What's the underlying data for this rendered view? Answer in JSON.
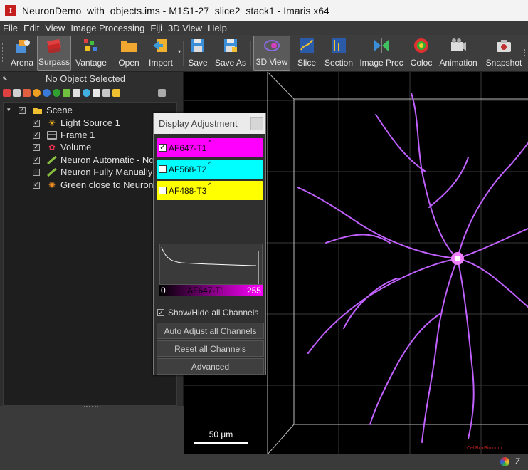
{
  "window": {
    "title": "NeuronDemo_with_objects.ims - M1S1-27_slice2_stack1 - Imaris x64",
    "app_icon": "I"
  },
  "menu": [
    "File",
    "Edit",
    "View",
    "Image Processing",
    "Fiji",
    "3D View",
    "Help"
  ],
  "toolbar": [
    {
      "label": "Arena",
      "icon": "arena-icon"
    },
    {
      "label": "Surpass",
      "icon": "surpass-icon",
      "active": true
    },
    {
      "label": "Vantage",
      "icon": "vantage-icon"
    },
    {
      "label": "Open",
      "icon": "open-folder-icon"
    },
    {
      "label": "Import",
      "icon": "import-icon"
    },
    {
      "label": "Save",
      "icon": "save-icon"
    },
    {
      "label": "Save As",
      "icon": "save-as-icon"
    },
    {
      "label": "3D View",
      "icon": "3d-view-icon",
      "active": true
    },
    {
      "label": "Slice",
      "icon": "slice-icon"
    },
    {
      "label": "Section",
      "icon": "section-icon"
    },
    {
      "label": "Image Proc",
      "icon": "image-proc-icon"
    },
    {
      "label": "Coloc",
      "icon": "coloc-icon"
    },
    {
      "label": "Animation",
      "icon": "animation-icon"
    },
    {
      "label": "Snapshot",
      "icon": "snapshot-icon"
    }
  ],
  "left_panel": {
    "selection_label": "No Object Selected",
    "tree": [
      {
        "label": "Scene",
        "checked": true,
        "expanded": true,
        "icon": "folder-icon",
        "level": 0
      },
      {
        "label": "Light Source 1",
        "checked": true,
        "icon": "sun-icon",
        "level": 1
      },
      {
        "label": "Frame 1",
        "checked": true,
        "icon": "frame-icon",
        "level": 1
      },
      {
        "label": "Volume",
        "checked": true,
        "icon": "volume-icon",
        "level": 1
      },
      {
        "label": "Neuron Automatic - No",
        "checked": true,
        "icon": "neuron-icon",
        "level": 1
      },
      {
        "label": "Neuron Fully Manually I",
        "checked": false,
        "icon": "neuron-icon",
        "level": 1
      },
      {
        "label": "Green close to Neuron",
        "checked": true,
        "icon": "spots-icon",
        "level": 1
      }
    ]
  },
  "display_adjustment": {
    "title": "Display Adjustment",
    "channels": [
      {
        "name": "AF647-T1",
        "checked": true,
        "color": "#ff00ff"
      },
      {
        "name": "AF568-T2",
        "checked": false,
        "color": "#00ffff"
      },
      {
        "name": "AF488-T3",
        "checked": false,
        "color": "#ffff00"
      }
    ],
    "range_min": "0",
    "range_channel": "AF647-T1",
    "range_max": "255",
    "show_hide_label": "Show/Hide all Channels",
    "show_hide_checked": true,
    "buttons": [
      "Auto Adjust all Channels",
      "Reset all Channels",
      "Advanced"
    ]
  },
  "viewer": {
    "scale_label": "50 µm",
    "watermark": "CellBoxBio.com"
  },
  "status": {
    "right_text": "Z"
  }
}
